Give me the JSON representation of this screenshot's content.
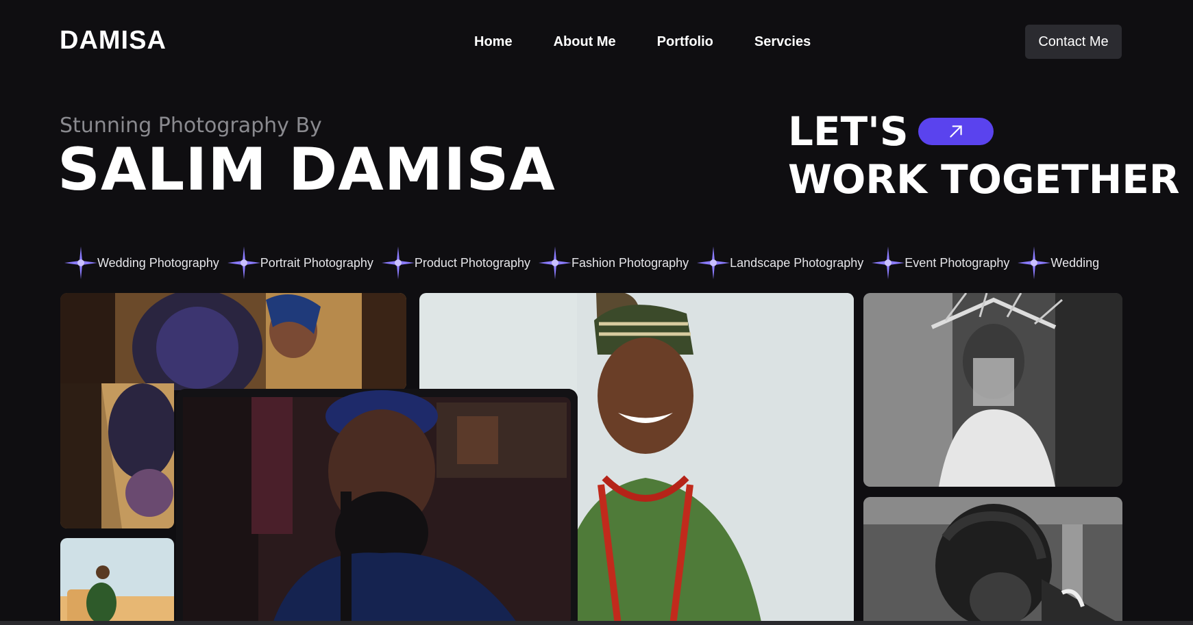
{
  "brand": {
    "logo": "DAMISA"
  },
  "nav": {
    "items": [
      "Home",
      "About Me",
      "Portfolio",
      "Servcies"
    ],
    "contact_label": "Contact Me"
  },
  "hero": {
    "subtitle": "Stunning Photography By",
    "name": "SALIM DAMISA",
    "cta_line1": "LET'S",
    "cta_line2": "WORK TOGETHER"
  },
  "services": [
    "Wedding Photography",
    "Portrait Photography",
    "Product Photography",
    "Fashion Photography",
    "Landscape Photography",
    "Event Photography",
    "Wedding"
  ],
  "colors": {
    "background": "#0f0e11",
    "accent": "#5a43ee",
    "button": "#2b2b30"
  }
}
